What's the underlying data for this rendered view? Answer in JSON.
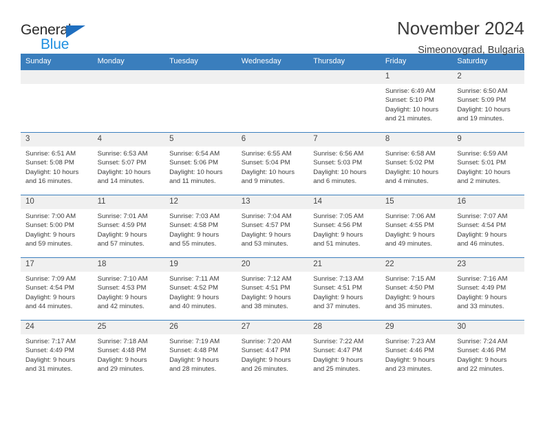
{
  "brand": {
    "name_part1": "General",
    "name_part2": "Blue",
    "triangle_color": "#1f6fc0",
    "blue_text_color": "#1f8fe0"
  },
  "header": {
    "title": "November 2024",
    "subtitle": "Simeonovgrad, Bulgaria",
    "header_bg_color": "#3a7ebd",
    "daynum_bg_color": "#f0f0f0"
  },
  "weekdays": [
    "Sunday",
    "Monday",
    "Tuesday",
    "Wednesday",
    "Thursday",
    "Friday",
    "Saturday"
  ],
  "labels": {
    "sunrise": "Sunrise:",
    "sunset": "Sunset:",
    "daylight": "Daylight:"
  },
  "weeks": [
    [
      {
        "day": "",
        "blank": true
      },
      {
        "day": "",
        "blank": true
      },
      {
        "day": "",
        "blank": true
      },
      {
        "day": "",
        "blank": true
      },
      {
        "day": "",
        "blank": true
      },
      {
        "day": "1",
        "sunrise": "Sunrise: 6:49 AM",
        "sunset": "Sunset: 5:10 PM",
        "daylight_line1": "Daylight: 10 hours",
        "daylight_line2": "and 21 minutes."
      },
      {
        "day": "2",
        "sunrise": "Sunrise: 6:50 AM",
        "sunset": "Sunset: 5:09 PM",
        "daylight_line1": "Daylight: 10 hours",
        "daylight_line2": "and 19 minutes."
      }
    ],
    [
      {
        "day": "3",
        "sunrise": "Sunrise: 6:51 AM",
        "sunset": "Sunset: 5:08 PM",
        "daylight_line1": "Daylight: 10 hours",
        "daylight_line2": "and 16 minutes."
      },
      {
        "day": "4",
        "sunrise": "Sunrise: 6:53 AM",
        "sunset": "Sunset: 5:07 PM",
        "daylight_line1": "Daylight: 10 hours",
        "daylight_line2": "and 14 minutes."
      },
      {
        "day": "5",
        "sunrise": "Sunrise: 6:54 AM",
        "sunset": "Sunset: 5:06 PM",
        "daylight_line1": "Daylight: 10 hours",
        "daylight_line2": "and 11 minutes."
      },
      {
        "day": "6",
        "sunrise": "Sunrise: 6:55 AM",
        "sunset": "Sunset: 5:04 PM",
        "daylight_line1": "Daylight: 10 hours",
        "daylight_line2": "and 9 minutes."
      },
      {
        "day": "7",
        "sunrise": "Sunrise: 6:56 AM",
        "sunset": "Sunset: 5:03 PM",
        "daylight_line1": "Daylight: 10 hours",
        "daylight_line2": "and 6 minutes."
      },
      {
        "day": "8",
        "sunrise": "Sunrise: 6:58 AM",
        "sunset": "Sunset: 5:02 PM",
        "daylight_line1": "Daylight: 10 hours",
        "daylight_line2": "and 4 minutes."
      },
      {
        "day": "9",
        "sunrise": "Sunrise: 6:59 AM",
        "sunset": "Sunset: 5:01 PM",
        "daylight_line1": "Daylight: 10 hours",
        "daylight_line2": "and 2 minutes."
      }
    ],
    [
      {
        "day": "10",
        "sunrise": "Sunrise: 7:00 AM",
        "sunset": "Sunset: 5:00 PM",
        "daylight_line1": "Daylight: 9 hours",
        "daylight_line2": "and 59 minutes."
      },
      {
        "day": "11",
        "sunrise": "Sunrise: 7:01 AM",
        "sunset": "Sunset: 4:59 PM",
        "daylight_line1": "Daylight: 9 hours",
        "daylight_line2": "and 57 minutes."
      },
      {
        "day": "12",
        "sunrise": "Sunrise: 7:03 AM",
        "sunset": "Sunset: 4:58 PM",
        "daylight_line1": "Daylight: 9 hours",
        "daylight_line2": "and 55 minutes."
      },
      {
        "day": "13",
        "sunrise": "Sunrise: 7:04 AM",
        "sunset": "Sunset: 4:57 PM",
        "daylight_line1": "Daylight: 9 hours",
        "daylight_line2": "and 53 minutes."
      },
      {
        "day": "14",
        "sunrise": "Sunrise: 7:05 AM",
        "sunset": "Sunset: 4:56 PM",
        "daylight_line1": "Daylight: 9 hours",
        "daylight_line2": "and 51 minutes."
      },
      {
        "day": "15",
        "sunrise": "Sunrise: 7:06 AM",
        "sunset": "Sunset: 4:55 PM",
        "daylight_line1": "Daylight: 9 hours",
        "daylight_line2": "and 49 minutes."
      },
      {
        "day": "16",
        "sunrise": "Sunrise: 7:07 AM",
        "sunset": "Sunset: 4:54 PM",
        "daylight_line1": "Daylight: 9 hours",
        "daylight_line2": "and 46 minutes."
      }
    ],
    [
      {
        "day": "17",
        "sunrise": "Sunrise: 7:09 AM",
        "sunset": "Sunset: 4:54 PM",
        "daylight_line1": "Daylight: 9 hours",
        "daylight_line2": "and 44 minutes."
      },
      {
        "day": "18",
        "sunrise": "Sunrise: 7:10 AM",
        "sunset": "Sunset: 4:53 PM",
        "daylight_line1": "Daylight: 9 hours",
        "daylight_line2": "and 42 minutes."
      },
      {
        "day": "19",
        "sunrise": "Sunrise: 7:11 AM",
        "sunset": "Sunset: 4:52 PM",
        "daylight_line1": "Daylight: 9 hours",
        "daylight_line2": "and 40 minutes."
      },
      {
        "day": "20",
        "sunrise": "Sunrise: 7:12 AM",
        "sunset": "Sunset: 4:51 PM",
        "daylight_line1": "Daylight: 9 hours",
        "daylight_line2": "and 38 minutes."
      },
      {
        "day": "21",
        "sunrise": "Sunrise: 7:13 AM",
        "sunset": "Sunset: 4:51 PM",
        "daylight_line1": "Daylight: 9 hours",
        "daylight_line2": "and 37 minutes."
      },
      {
        "day": "22",
        "sunrise": "Sunrise: 7:15 AM",
        "sunset": "Sunset: 4:50 PM",
        "daylight_line1": "Daylight: 9 hours",
        "daylight_line2": "and 35 minutes."
      },
      {
        "day": "23",
        "sunrise": "Sunrise: 7:16 AM",
        "sunset": "Sunset: 4:49 PM",
        "daylight_line1": "Daylight: 9 hours",
        "daylight_line2": "and 33 minutes."
      }
    ],
    [
      {
        "day": "24",
        "sunrise": "Sunrise: 7:17 AM",
        "sunset": "Sunset: 4:49 PM",
        "daylight_line1": "Daylight: 9 hours",
        "daylight_line2": "and 31 minutes."
      },
      {
        "day": "25",
        "sunrise": "Sunrise: 7:18 AM",
        "sunset": "Sunset: 4:48 PM",
        "daylight_line1": "Daylight: 9 hours",
        "daylight_line2": "and 29 minutes."
      },
      {
        "day": "26",
        "sunrise": "Sunrise: 7:19 AM",
        "sunset": "Sunset: 4:48 PM",
        "daylight_line1": "Daylight: 9 hours",
        "daylight_line2": "and 28 minutes."
      },
      {
        "day": "27",
        "sunrise": "Sunrise: 7:20 AM",
        "sunset": "Sunset: 4:47 PM",
        "daylight_line1": "Daylight: 9 hours",
        "daylight_line2": "and 26 minutes."
      },
      {
        "day": "28",
        "sunrise": "Sunrise: 7:22 AM",
        "sunset": "Sunset: 4:47 PM",
        "daylight_line1": "Daylight: 9 hours",
        "daylight_line2": "and 25 minutes."
      },
      {
        "day": "29",
        "sunrise": "Sunrise: 7:23 AM",
        "sunset": "Sunset: 4:46 PM",
        "daylight_line1": "Daylight: 9 hours",
        "daylight_line2": "and 23 minutes."
      },
      {
        "day": "30",
        "sunrise": "Sunrise: 7:24 AM",
        "sunset": "Sunset: 4:46 PM",
        "daylight_line1": "Daylight: 9 hours",
        "daylight_line2": "and 22 minutes."
      }
    ]
  ]
}
